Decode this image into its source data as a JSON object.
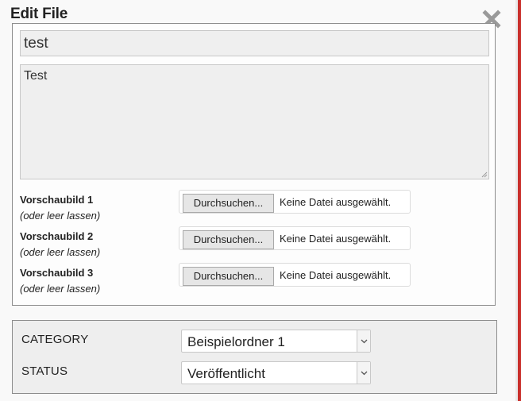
{
  "dialog": {
    "title": "Edit File",
    "close_icon": "close-icon"
  },
  "file_form": {
    "title_value": "test",
    "description_value": "Test",
    "thumbnails": [
      {
        "label": "Vorschaubild 1",
        "hint": "(oder leer lassen)",
        "button_label": "Durchsuchen...",
        "status": "Keine Datei ausgewählt."
      },
      {
        "label": "Vorschaubild 2",
        "hint": "(oder leer lassen)",
        "button_label": "Durchsuchen...",
        "status": "Keine Datei ausgewählt."
      },
      {
        "label": "Vorschaubild 3",
        "hint": "(oder leer lassen)",
        "button_label": "Durchsuchen...",
        "status": "Keine Datei ausgewählt."
      }
    ]
  },
  "meta": {
    "category_label": "CATEGORY",
    "category_value": "Beispielordner 1",
    "status_label": "STATUS",
    "status_value": "Veröffentlicht"
  },
  "colors": {
    "accent_edge": "#c9302c",
    "field_background": "#efefef",
    "panel_border": "#8c8c8c"
  }
}
